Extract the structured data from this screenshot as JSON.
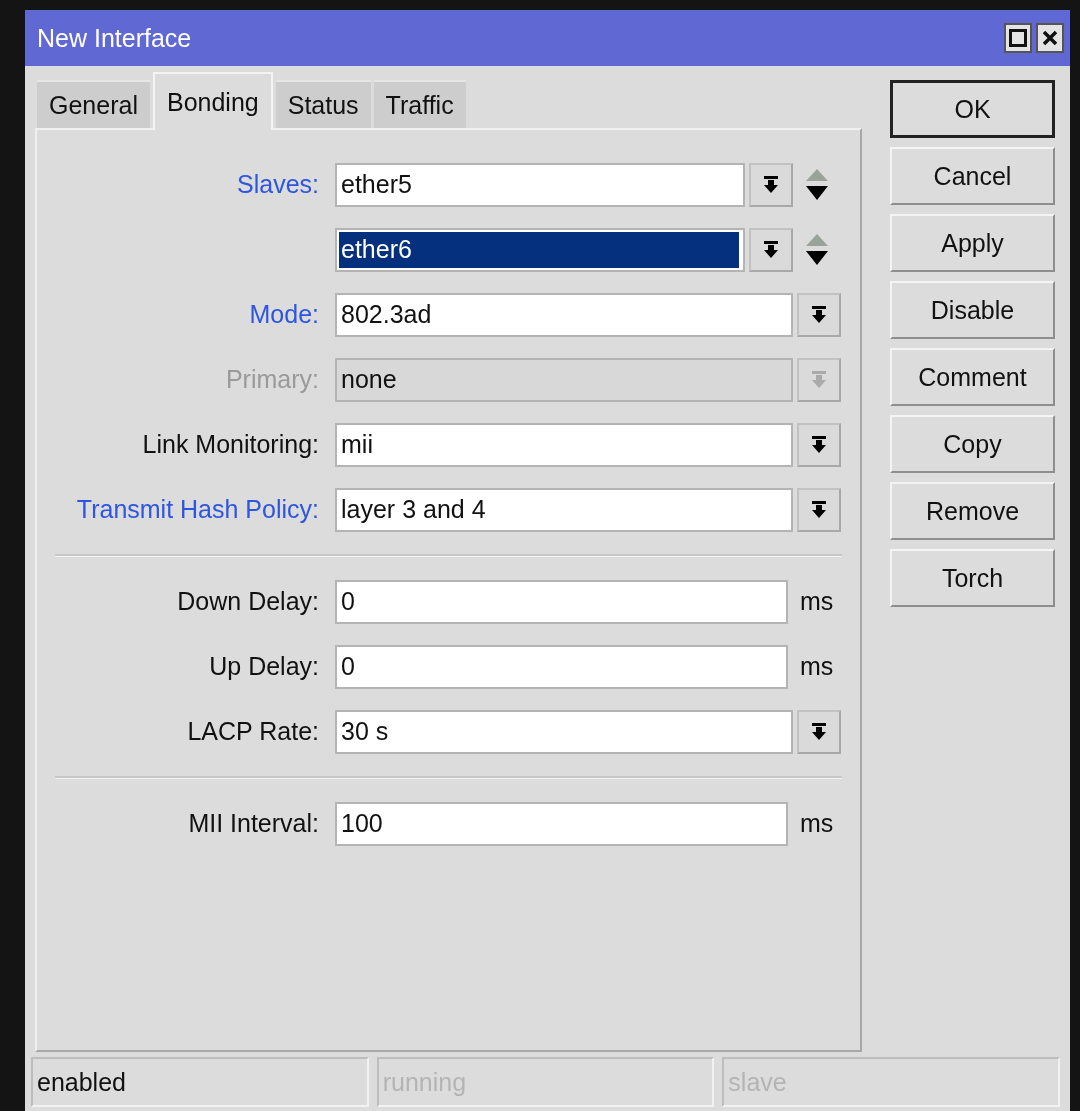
{
  "window": {
    "title": "New Interface"
  },
  "tabs": [
    {
      "label": "General",
      "selected": false
    },
    {
      "label": "Bonding",
      "selected": true
    },
    {
      "label": "Status",
      "selected": false
    },
    {
      "label": "Traffic",
      "selected": false
    }
  ],
  "field_groups": [
    {
      "fields": [
        {
          "kind": "slave",
          "label": "Slaves:",
          "required": true,
          "disabled": false,
          "value": "ether5",
          "selected": false
        },
        {
          "kind": "slave",
          "value": "ether6",
          "disabled": false,
          "selected": true
        },
        {
          "kind": "combo",
          "label": "Mode:",
          "required": true,
          "disabled": false,
          "value": "802.3ad",
          "selected": false
        },
        {
          "kind": "combo",
          "label": "Primary:",
          "required": false,
          "disabled": true,
          "value": "none",
          "selected": false
        },
        {
          "kind": "combo",
          "label": "Link Monitoring:",
          "required": false,
          "disabled": false,
          "value": "mii",
          "selected": false
        },
        {
          "kind": "combo",
          "label": "Transmit Hash Policy:",
          "required": true,
          "disabled": false,
          "value": "layer 3 and 4",
          "selected": false
        }
      ]
    },
    {
      "fields": [
        {
          "kind": "text",
          "label": "Down Delay:",
          "required": false,
          "disabled": false,
          "value": "0",
          "unit": "ms",
          "selected": false
        },
        {
          "kind": "text",
          "label": "Up Delay:",
          "required": false,
          "disabled": false,
          "value": "0",
          "unit": "ms",
          "selected": false
        },
        {
          "kind": "combo",
          "label": "LACP Rate:",
          "required": false,
          "disabled": false,
          "value": "30 s",
          "selected": false
        }
      ]
    },
    {
      "fields": [
        {
          "kind": "text",
          "label": "MII Interval:",
          "required": false,
          "disabled": false,
          "value": "100",
          "unit": "ms",
          "selected": false
        }
      ]
    }
  ],
  "buttons": [
    {
      "label": "OK",
      "default": true
    },
    {
      "label": "Cancel",
      "default": false
    },
    {
      "label": "Apply",
      "default": false
    },
    {
      "label": "Disable",
      "default": false
    },
    {
      "label": "Comment",
      "default": false
    },
    {
      "label": "Copy",
      "default": false
    },
    {
      "label": "Remove",
      "default": false
    },
    {
      "label": "Torch",
      "default": false
    }
  ],
  "status_bar": [
    {
      "text": "enabled",
      "disabled": false
    },
    {
      "text": "running",
      "disabled": true
    },
    {
      "text": "slave",
      "disabled": true
    }
  ]
}
